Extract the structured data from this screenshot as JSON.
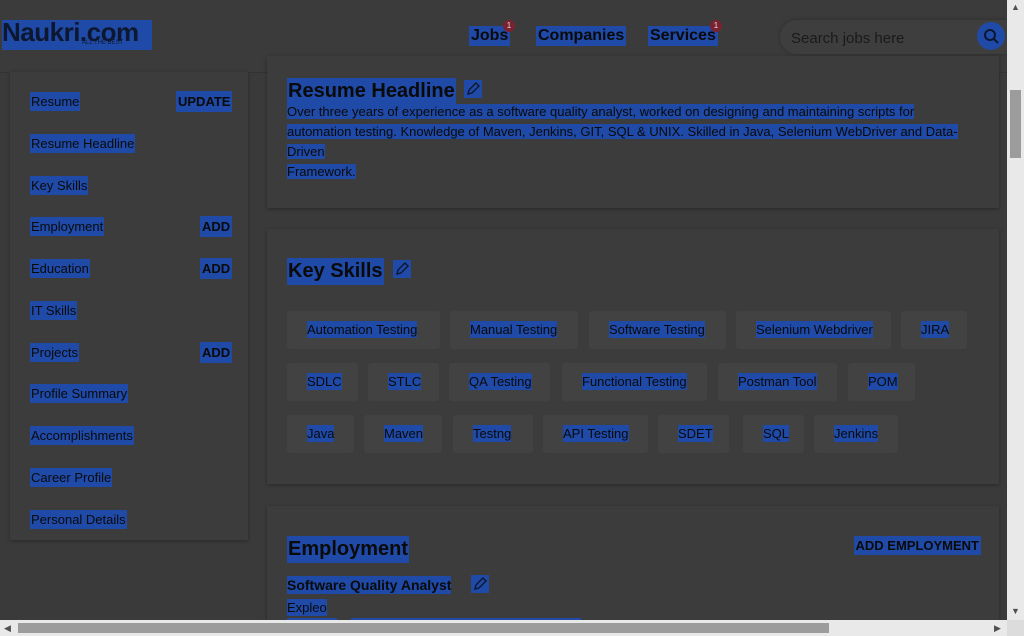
{
  "header": {
    "logo_text": "Naukri.com",
    "logo_tagline": "ALL THE BEST",
    "nav": [
      {
        "label": "Jobs",
        "badge": "1"
      },
      {
        "label": "Companies"
      },
      {
        "label": "Services",
        "badge": "1"
      }
    ],
    "search_placeholder": "Search jobs here"
  },
  "sidebar": {
    "items": [
      {
        "label": "Resume",
        "action": "UPDATE"
      },
      {
        "label": "Resume Headline"
      },
      {
        "label": "Key Skills"
      },
      {
        "label": "Employment",
        "action": "ADD"
      },
      {
        "label": "Education",
        "action": "ADD"
      },
      {
        "label": "IT Skills"
      },
      {
        "label": "Projects",
        "action": "ADD"
      },
      {
        "label": "Profile Summary"
      },
      {
        "label": "Accomplishments"
      },
      {
        "label": "Career Profile"
      },
      {
        "label": "Personal Details"
      }
    ]
  },
  "headline": {
    "title": "Resume Headline",
    "lines": [
      "Over three years of experience as a software quality analyst, worked on designing and maintaining scripts for",
      "automation testing. Knowledge of Maven, Jenkins, GIT, SQL & UNIX. Skilled in Java, Selenium WebDriver and Data-Driven",
      "Framework."
    ]
  },
  "key_skills": {
    "title": "Key Skills",
    "skills": [
      "Automation Testing",
      "Manual Testing",
      "Software Testing",
      "Selenium Webdriver",
      "JIRA",
      "SDLC",
      "STLC",
      "QA Testing",
      "Functional Testing",
      "Postman Tool",
      "POM",
      "Java",
      "Maven",
      "Testng",
      "API Testing",
      "SDET",
      "SQL",
      "Jenkins"
    ]
  },
  "employment": {
    "title": "Employment",
    "add_label": "ADD EMPLOYMENT",
    "job_title": "Software Quality Analyst",
    "company": "Expleo"
  },
  "colors": {
    "selection": "#1f4aa8",
    "background": "#3a3a3a",
    "badge": "#7a2230"
  }
}
